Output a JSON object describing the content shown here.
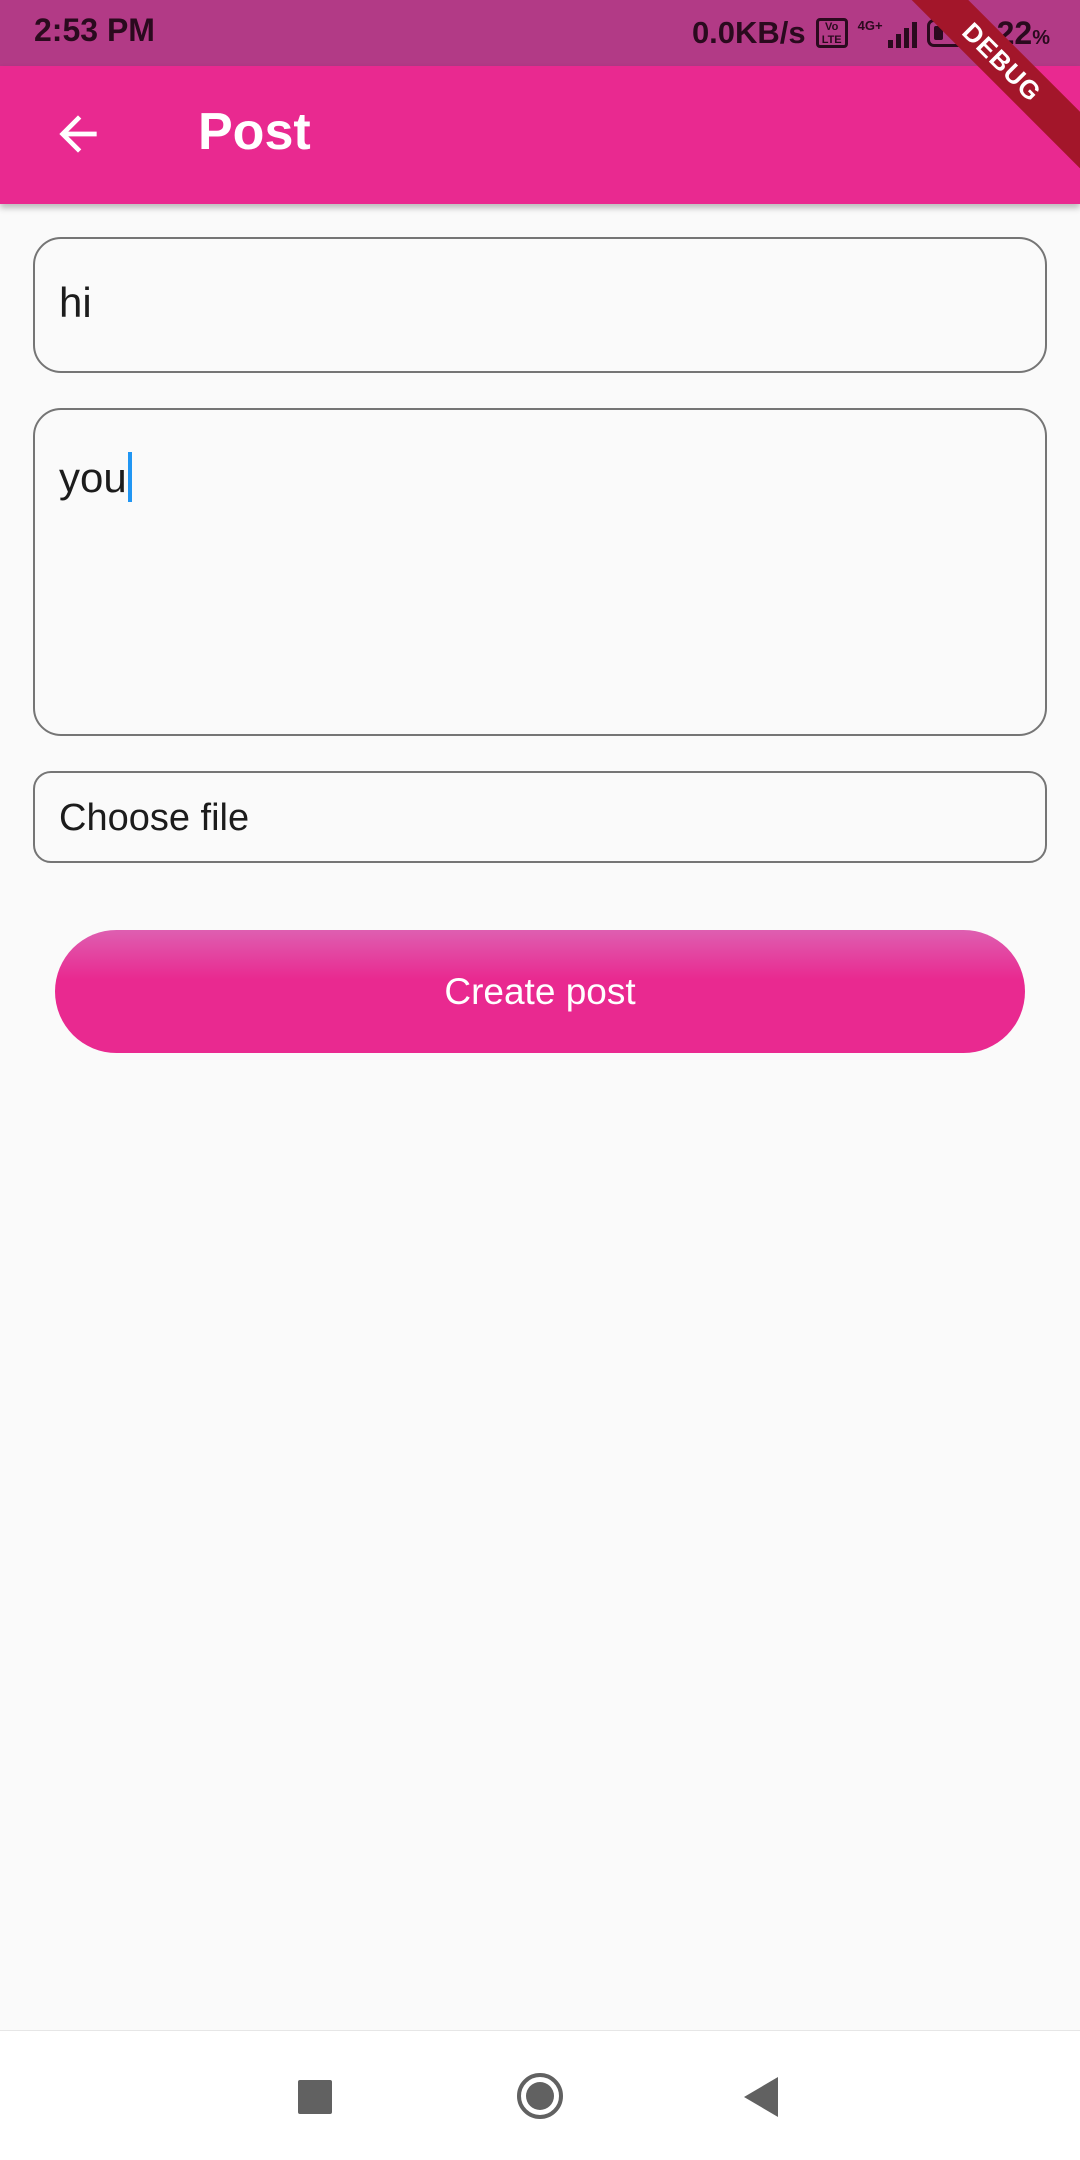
{
  "status_bar": {
    "time": "2:53 PM",
    "net_speed": "0.0KB/s",
    "volte_label": "Vo LTE",
    "network_type": "4G+",
    "battery_percent": "22",
    "battery_suffix": "%",
    "battery_level": 0.22
  },
  "app_bar": {
    "back_icon": "arrow-left-icon",
    "title": "Post"
  },
  "debug_banner": {
    "label": "DEBUG"
  },
  "form": {
    "title_value": "hi",
    "body_value": "you",
    "file_label": "Choose file",
    "submit_label": "Create post"
  },
  "nav_bar": {
    "recent_icon": "square-icon",
    "home_icon": "circle-icon",
    "back_icon": "triangle-back-icon"
  },
  "colors": {
    "primary": "#e92990",
    "status_bar": "#b23a86",
    "caret": "#2196f3",
    "debug": "#a3162a"
  }
}
